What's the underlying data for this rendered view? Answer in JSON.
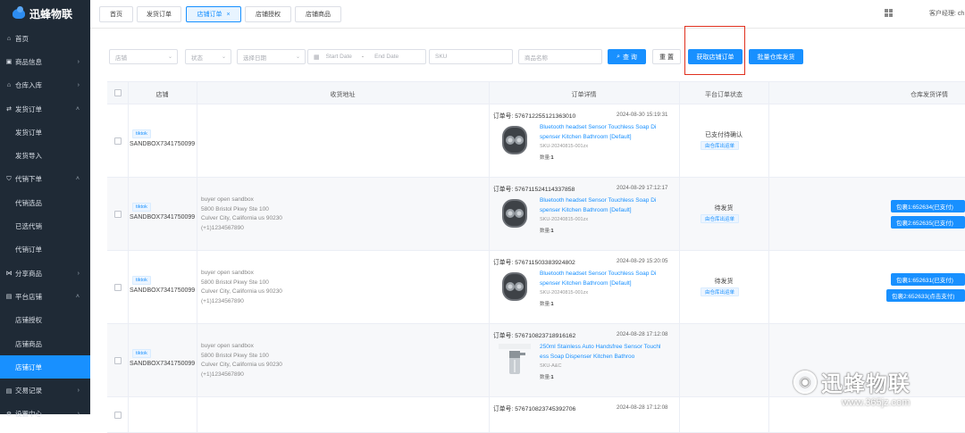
{
  "app": {
    "title": "迅蜂物联"
  },
  "sidebar": {
    "items": [
      {
        "label": "首页",
        "icon": "home-icon",
        "chevron": "",
        "sub": false
      },
      {
        "label": "商品信息",
        "icon": "box-icon",
        "chevron": "›",
        "sub": false
      },
      {
        "label": "仓库入库",
        "icon": "warehouse-icon",
        "chevron": "›",
        "sub": false
      },
      {
        "label": "发货订单",
        "icon": "truck-icon",
        "chevron": "˄",
        "sub": false
      },
      {
        "label": "发货订单",
        "icon": "",
        "chevron": "",
        "sub": true
      },
      {
        "label": "发货导入",
        "icon": "",
        "chevron": "",
        "sub": true
      },
      {
        "label": "代销下单",
        "icon": "cart-icon",
        "chevron": "˄",
        "sub": false
      },
      {
        "label": "代销选品",
        "icon": "",
        "chevron": "",
        "sub": true
      },
      {
        "label": "已选代销",
        "icon": "",
        "chevron": "",
        "sub": true
      },
      {
        "label": "代销订单",
        "icon": "",
        "chevron": "",
        "sub": true
      },
      {
        "label": "分享商品",
        "icon": "share-icon",
        "chevron": "›",
        "sub": false
      },
      {
        "label": "平台店铺",
        "icon": "store-icon",
        "chevron": "˄",
        "sub": false
      },
      {
        "label": "店铺授权",
        "icon": "",
        "chevron": "",
        "sub": true
      },
      {
        "label": "店铺商品",
        "icon": "",
        "chevron": "",
        "sub": true
      },
      {
        "label": "店铺订单",
        "icon": "",
        "chevron": "",
        "sub": true,
        "active": true
      },
      {
        "label": "交易记录",
        "icon": "receipt-icon",
        "chevron": "›",
        "sub": false
      },
      {
        "label": "设置中心",
        "icon": "settings-icon",
        "chevron": "›",
        "sub": false
      }
    ]
  },
  "tabs": [
    {
      "label": "首页",
      "active": false
    },
    {
      "label": "发货订单",
      "active": false
    },
    {
      "label": "店铺订单",
      "active": true,
      "close": "×"
    },
    {
      "label": "店铺授权",
      "active": false
    },
    {
      "label": "店铺商品",
      "active": false
    }
  ],
  "header": {
    "manager": "客户经理: ch"
  },
  "filters": {
    "store": "店铺",
    "status": "状态",
    "date_type": "选择日期",
    "start_date": "Start Date",
    "date_sep": "-",
    "end_date": "End Date",
    "sku": "SKU",
    "product_name": "商品名称",
    "query": "查 询",
    "reset": "重 置",
    "fetch_orders": "获取店铺订单",
    "bulk_ship": "批量仓库发货"
  },
  "table": {
    "headers": [
      "店铺",
      "收货地址",
      "订单详情",
      "平台订单状态",
      "仓库发货详情"
    ],
    "rows": [
      {
        "tag": "tiktok",
        "store": "SANDBOX7341750099",
        "address": [],
        "order_label": "订单号:",
        "order_no": "576712255121363010",
        "time": "2024-08-30 15:19:31",
        "product_lines": [
          "Bluetooth headset Sensor Touchless Soap Di",
          "spenser Kitchen Bathroom  [Default]"
        ],
        "sku": "SKU-20240815-001zx",
        "qty_label": "数量:",
        "qty": "1",
        "status": "已支付待确认",
        "status_link": "由仓库出运单",
        "packages": []
      },
      {
        "tag": "tiktok",
        "store": "SANDBOX7341750099",
        "address": [
          "buyer open sandbox",
          "5800 Bristol Pkwy Ste 100",
          "Culver City, California   us  90230",
          "(+1)1234567890"
        ],
        "order_label": "订单号:",
        "order_no": "576711524114337858",
        "time": "2024-08-29 17:12:17",
        "product_lines": [
          "Bluetooth headset Sensor Touchless Soap Di",
          "spenser Kitchen Bathroom  [Default]"
        ],
        "sku": "SKU-20240815-001zx",
        "qty_label": "数量:",
        "qty": "1",
        "status": "待发货",
        "status_link": "由仓库出运单",
        "packages": [
          "包裹1:652634(已支付)",
          "包裹2:652635(已支付)"
        ]
      },
      {
        "tag": "tiktok",
        "store": "SANDBOX7341750099",
        "address": [
          "buyer open sandbox",
          "5800 Bristol Pkwy Ste 100",
          "Culver City, California   us  90230",
          "(+1)1234567890"
        ],
        "order_label": "订单号:",
        "order_no": "576711503383924802",
        "time": "2024-08-29 15:20:05",
        "product_lines": [
          "Bluetooth headset Sensor Touchless Soap Di",
          "spenser Kitchen Bathroom  [Default]"
        ],
        "sku": "SKU-20240815-001zx",
        "qty_label": "数量:",
        "qty": "1",
        "status": "待发货",
        "status_link": "由仓库出运单",
        "packages": [
          "包裹1:652631(已支付)",
          "包裹2:652633(点击支付)"
        ]
      },
      {
        "tag": "tiktok",
        "store": "SANDBOX7341750099",
        "address": [
          "buyer open sandbox",
          "5800 Bristol Pkwy Ste 100",
          "Culver City, California   us  90230",
          "(+1)1234567890"
        ],
        "order_label": "订单号:",
        "order_no": "576710823718916162",
        "time": "2024-08-28 17:12:08",
        "product_lines": [
          "250ml Stainless Auto Handsfree Sensor Touchl",
          "ess Soap Dispenser Kitchen Bathroo"
        ],
        "sku": "SKU-A&C",
        "qty_label": "数量:",
        "qty": "1",
        "status": "",
        "status_link": "",
        "packages": []
      },
      {
        "tag": "",
        "store": "",
        "address": [],
        "order_label": "订单号:",
        "order_no": "576710823745392706",
        "time": "2024-08-28 17:12:08",
        "product_lines": [],
        "sku": "",
        "qty_label": "",
        "qty": "",
        "status": "",
        "status_link": "",
        "packages": []
      }
    ]
  },
  "watermark": {
    "text": "迅蜂物联",
    "url": "www.365jz.com"
  },
  "colors": {
    "primary": "#1890ff",
    "sidebar": "#1f2a36",
    "highlight": "#e0301e"
  }
}
